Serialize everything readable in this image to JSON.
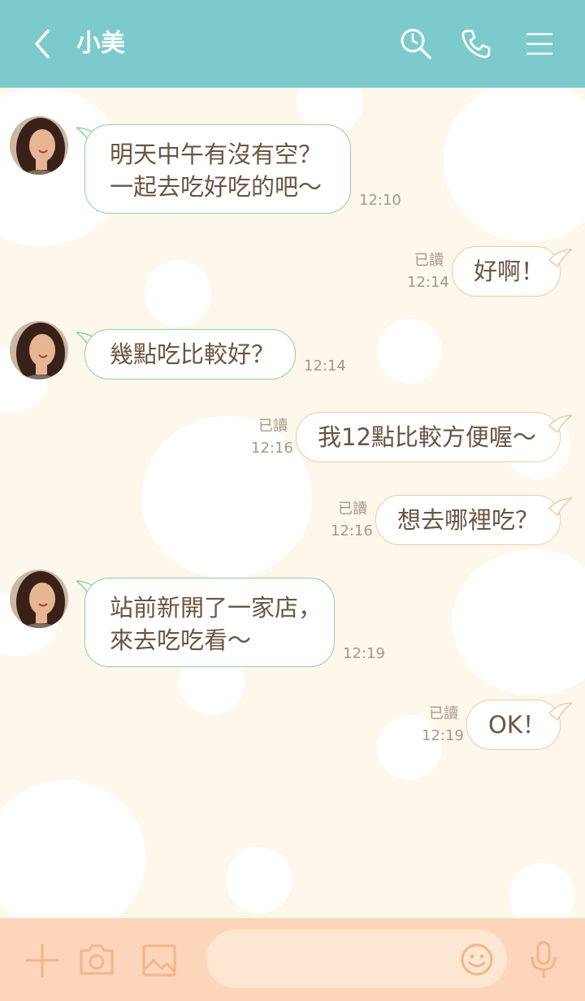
{
  "header": {
    "title": "小美",
    "icons": {
      "back": "chevron-left-icon",
      "search": "search-clock-icon",
      "call": "phone-icon",
      "menu": "hamburger-menu-icon"
    }
  },
  "messages": [
    {
      "side": "in",
      "text": "明天中午有沒有空？\n一起去吃好吃的吧～",
      "time": "12:10"
    },
    {
      "side": "out",
      "text": "好啊！",
      "time": "12:14",
      "read": "已讀"
    },
    {
      "side": "in",
      "text": "幾點吃比較好？",
      "time": "12:14"
    },
    {
      "side": "out",
      "text": "我12點比較方便喔～",
      "time": "12:16",
      "read": "已讀"
    },
    {
      "side": "out",
      "text": "想去哪裡吃？",
      "time": "12:16",
      "read": "已讀"
    },
    {
      "side": "in",
      "text": "站前新開了一家店，\n來去吃吃看～",
      "time": "12:19"
    },
    {
      "side": "out",
      "text": "OK！",
      "time": "12:19",
      "read": "已讀"
    }
  ],
  "footer": {
    "input_value": "",
    "icons": {
      "plus": "plus-icon",
      "camera": "camera-icon",
      "image": "image-icon",
      "emoji": "emoji-icon",
      "mic": "microphone-icon"
    }
  },
  "colors": {
    "header": "#7ccacb",
    "background": "#fdf7ec",
    "footer": "#fdd5ba",
    "text": "#6b5443",
    "incoming_border": "#8fd19f",
    "outgoing_border": "#f3c9a4",
    "footer_icon": "#f4b48a"
  }
}
